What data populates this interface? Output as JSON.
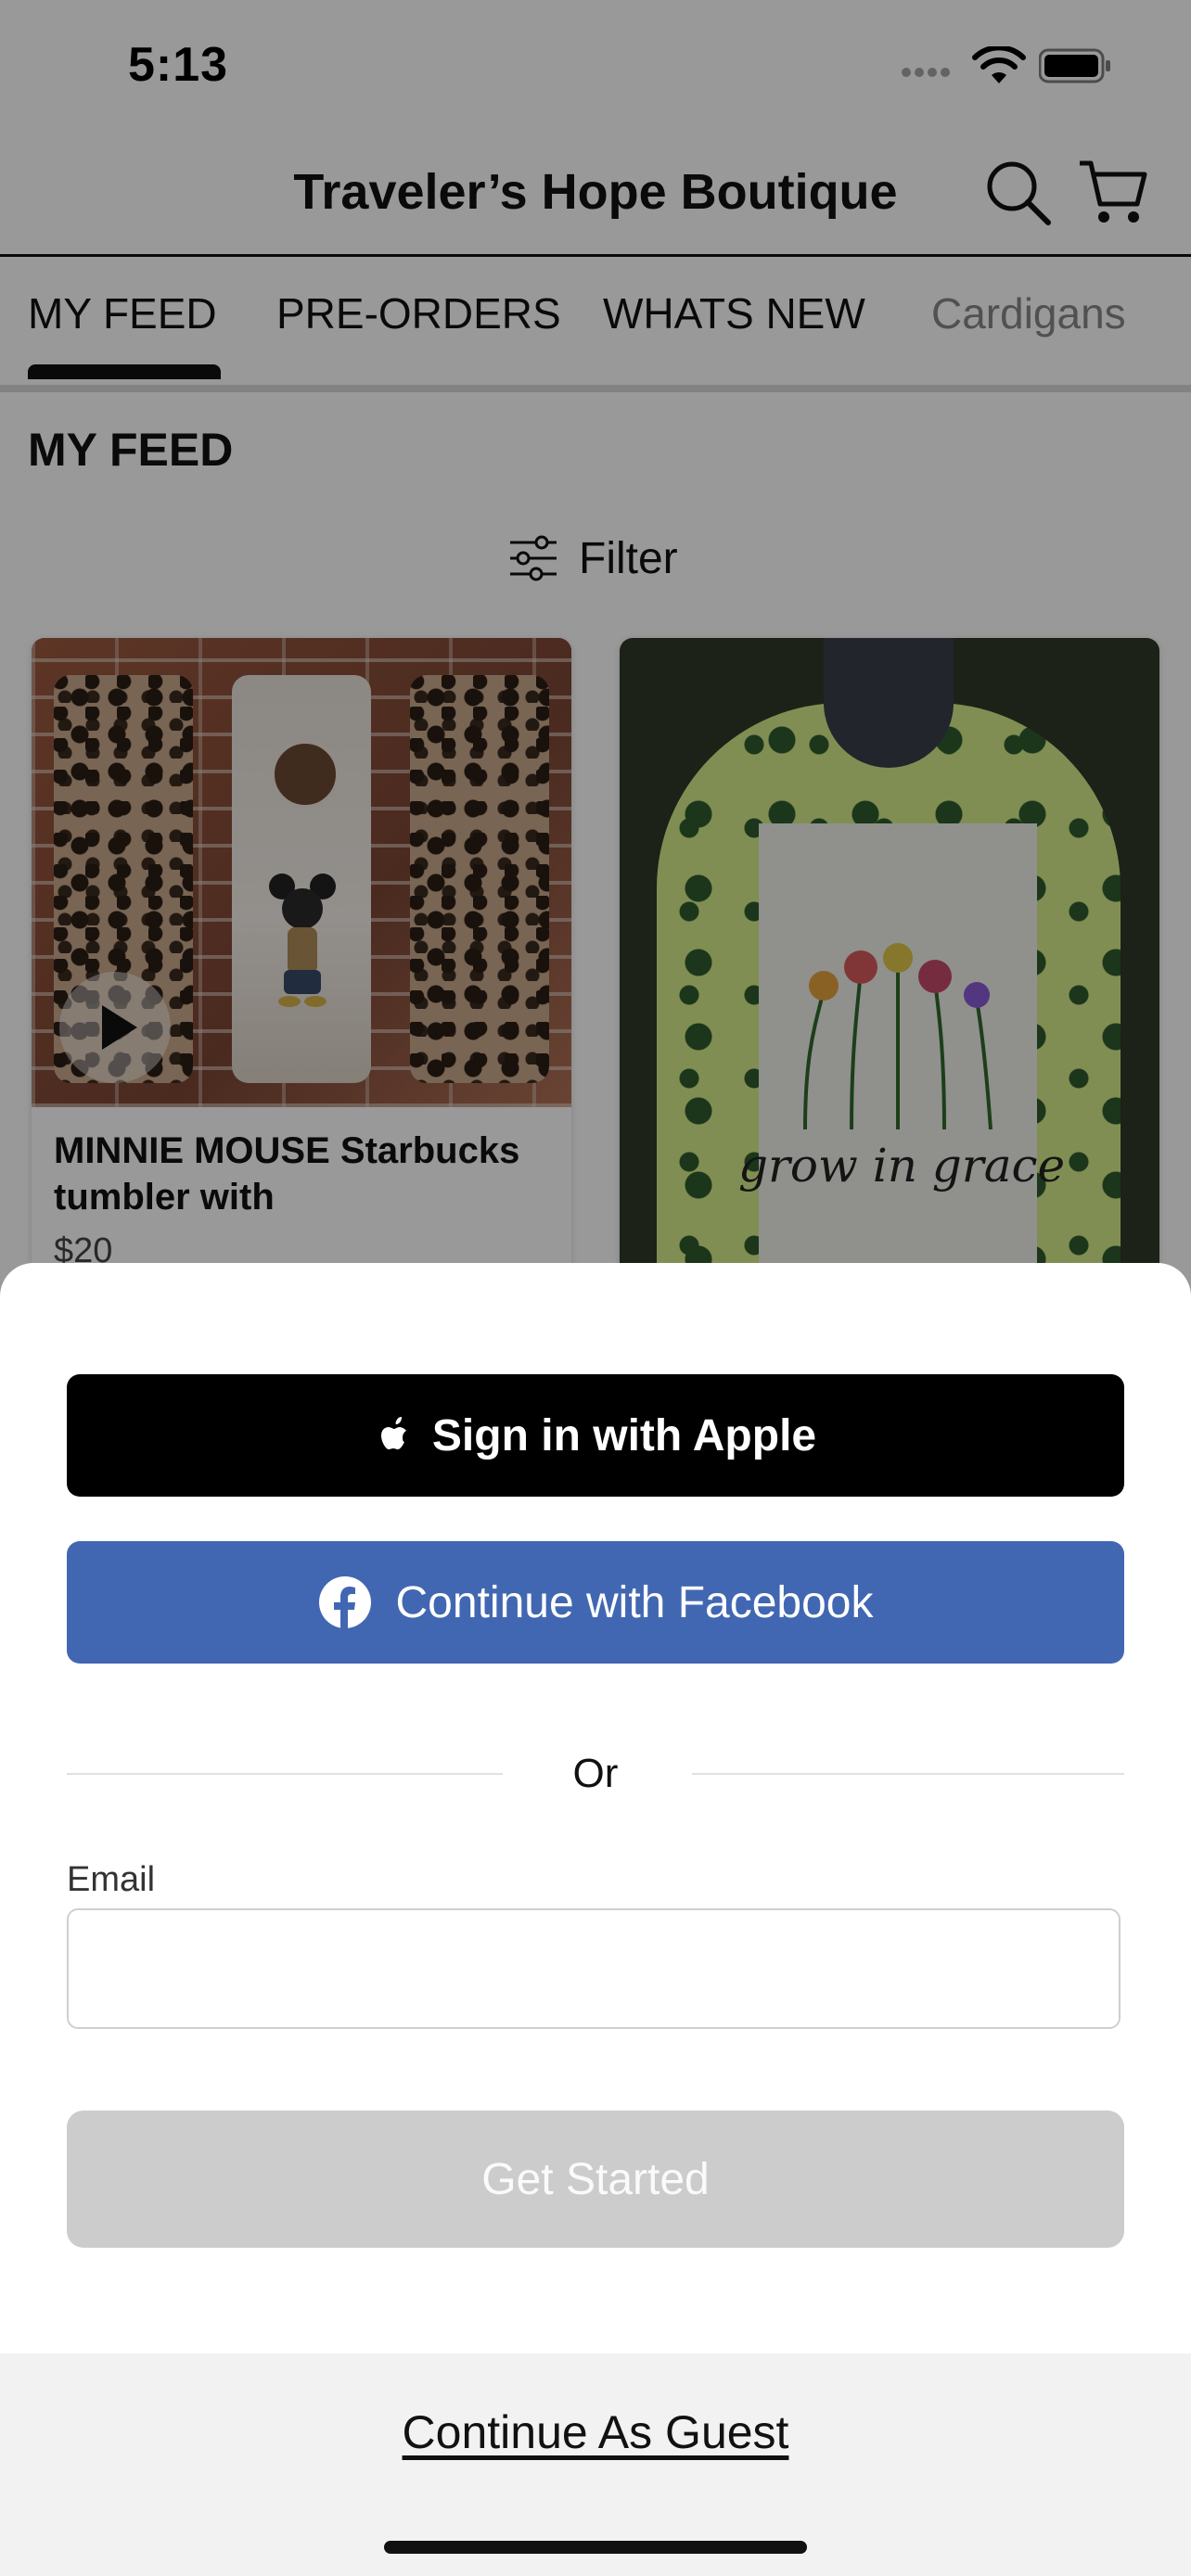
{
  "status_bar": {
    "time": "5:13"
  },
  "header": {
    "title": "Traveler’s Hope Boutique"
  },
  "tabs": [
    {
      "label": "MY FEED",
      "active": true
    },
    {
      "label": "PRE-ORDERS"
    },
    {
      "label": "WHATS NEW"
    },
    {
      "label": "Cardigans"
    }
  ],
  "feed": {
    "title": "MY FEED",
    "filter_label": "Filter",
    "products": [
      {
        "name": "MINNIE MOUSE Starbucks tumbler with",
        "price": "$20",
        "has_video": true
      },
      {
        "image_text": "grow in grace"
      }
    ]
  },
  "sheet": {
    "apple_label": "Sign in with Apple",
    "facebook_label": "Continue with Facebook",
    "or_text": "Or",
    "email_label": "Email",
    "email_value": "",
    "email_placeholder": "",
    "get_started_label": "Get Started",
    "guest_label": "Continue As Guest"
  },
  "colors": {
    "facebook_blue": "#4267b2",
    "apple_black": "#000000",
    "disabled_gray": "#cccccc",
    "overlay": "rgba(0,0,0,0.40)"
  }
}
